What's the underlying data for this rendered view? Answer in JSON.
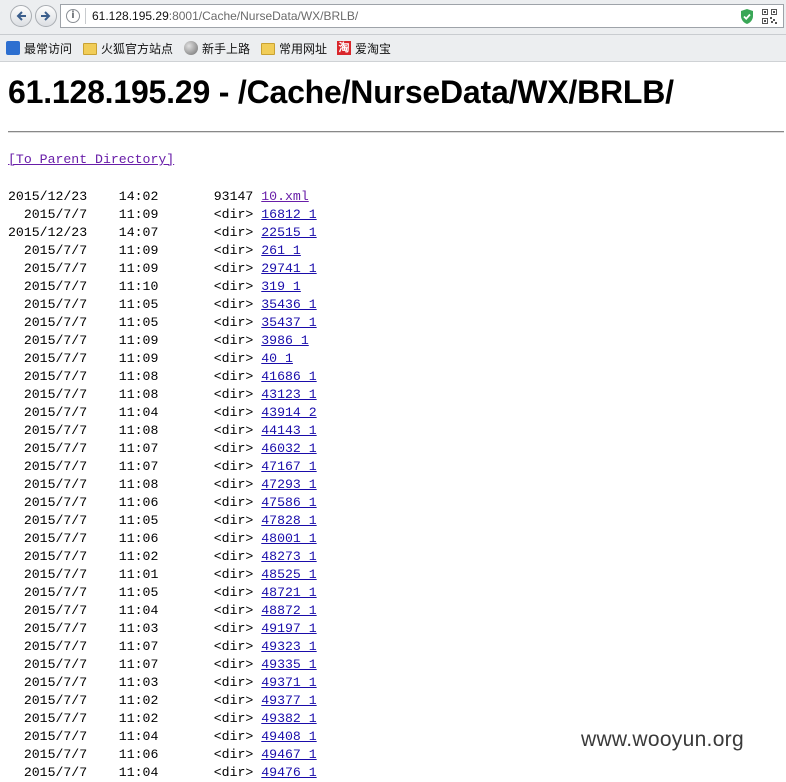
{
  "browser": {
    "url_host": "61.128.195.29",
    "url_rest": ":8001/Cache/NurseData/WX/BRLB/",
    "bookmarks": [
      {
        "label": "最常访问",
        "icon": "most-visited-icon"
      },
      {
        "label": "火狐官方站点",
        "icon": "folder-icon"
      },
      {
        "label": "新手上路",
        "icon": "globe-icon"
      },
      {
        "label": "常用网址",
        "icon": "folder-icon"
      },
      {
        "label": "爱淘宝",
        "icon": "taobao-icon"
      }
    ],
    "taobao_glyph": "淘",
    "info_glyph": "i"
  },
  "page": {
    "heading": "61.128.195.29 - /Cache/NurseData/WX/BRLB/",
    "parent_link": "[To Parent Directory]",
    "entries": [
      {
        "date": "2015/12/23",
        "time": "14:02",
        "size": "93147",
        "name": "10.xml"
      },
      {
        "date": "2015/7/7",
        "time": "11:09",
        "size": "<dir>",
        "name": "16812_1"
      },
      {
        "date": "2015/12/23",
        "time": "14:07",
        "size": "<dir>",
        "name": "22515_1"
      },
      {
        "date": "2015/7/7",
        "time": "11:09",
        "size": "<dir>",
        "name": "261_1"
      },
      {
        "date": "2015/7/7",
        "time": "11:09",
        "size": "<dir>",
        "name": "29741_1"
      },
      {
        "date": "2015/7/7",
        "time": "11:10",
        "size": "<dir>",
        "name": "319_1"
      },
      {
        "date": "2015/7/7",
        "time": "11:05",
        "size": "<dir>",
        "name": "35436_1"
      },
      {
        "date": "2015/7/7",
        "time": "11:05",
        "size": "<dir>",
        "name": "35437_1"
      },
      {
        "date": "2015/7/7",
        "time": "11:09",
        "size": "<dir>",
        "name": "3986_1"
      },
      {
        "date": "2015/7/7",
        "time": "11:09",
        "size": "<dir>",
        "name": "40_1"
      },
      {
        "date": "2015/7/7",
        "time": "11:08",
        "size": "<dir>",
        "name": "41686_1"
      },
      {
        "date": "2015/7/7",
        "time": "11:08",
        "size": "<dir>",
        "name": "43123_1"
      },
      {
        "date": "2015/7/7",
        "time": "11:04",
        "size": "<dir>",
        "name": "43914_2"
      },
      {
        "date": "2015/7/7",
        "time": "11:08",
        "size": "<dir>",
        "name": "44143_1"
      },
      {
        "date": "2015/7/7",
        "time": "11:07",
        "size": "<dir>",
        "name": "46032_1"
      },
      {
        "date": "2015/7/7",
        "time": "11:07",
        "size": "<dir>",
        "name": "47167_1"
      },
      {
        "date": "2015/7/7",
        "time": "11:08",
        "size": "<dir>",
        "name": "47293_1"
      },
      {
        "date": "2015/7/7",
        "time": "11:06",
        "size": "<dir>",
        "name": "47586_1"
      },
      {
        "date": "2015/7/7",
        "time": "11:05",
        "size": "<dir>",
        "name": "47828_1"
      },
      {
        "date": "2015/7/7",
        "time": "11:06",
        "size": "<dir>",
        "name": "48001_1"
      },
      {
        "date": "2015/7/7",
        "time": "11:02",
        "size": "<dir>",
        "name": "48273_1"
      },
      {
        "date": "2015/7/7",
        "time": "11:01",
        "size": "<dir>",
        "name": "48525_1"
      },
      {
        "date": "2015/7/7",
        "time": "11:05",
        "size": "<dir>",
        "name": "48721_1"
      },
      {
        "date": "2015/7/7",
        "time": "11:04",
        "size": "<dir>",
        "name": "48872_1"
      },
      {
        "date": "2015/7/7",
        "time": "11:03",
        "size": "<dir>",
        "name": "49197_1"
      },
      {
        "date": "2015/7/7",
        "time": "11:07",
        "size": "<dir>",
        "name": "49323_1"
      },
      {
        "date": "2015/7/7",
        "time": "11:07",
        "size": "<dir>",
        "name": "49335_1"
      },
      {
        "date": "2015/7/7",
        "time": "11:03",
        "size": "<dir>",
        "name": "49371_1"
      },
      {
        "date": "2015/7/7",
        "time": "11:02",
        "size": "<dir>",
        "name": "49377_1"
      },
      {
        "date": "2015/7/7",
        "time": "11:02",
        "size": "<dir>",
        "name": "49382_1"
      },
      {
        "date": "2015/7/7",
        "time": "11:04",
        "size": "<dir>",
        "name": "49408_1"
      },
      {
        "date": "2015/7/7",
        "time": "11:06",
        "size": "<dir>",
        "name": "49467_1"
      },
      {
        "date": "2015/7/7",
        "time": "11:04",
        "size": "<dir>",
        "name": "49476_1"
      }
    ]
  },
  "watermark": "www.wooyun.org",
  "colors": {
    "link": "#1a0dab",
    "visited_link": "#681da8",
    "shield": "#3aa757"
  }
}
